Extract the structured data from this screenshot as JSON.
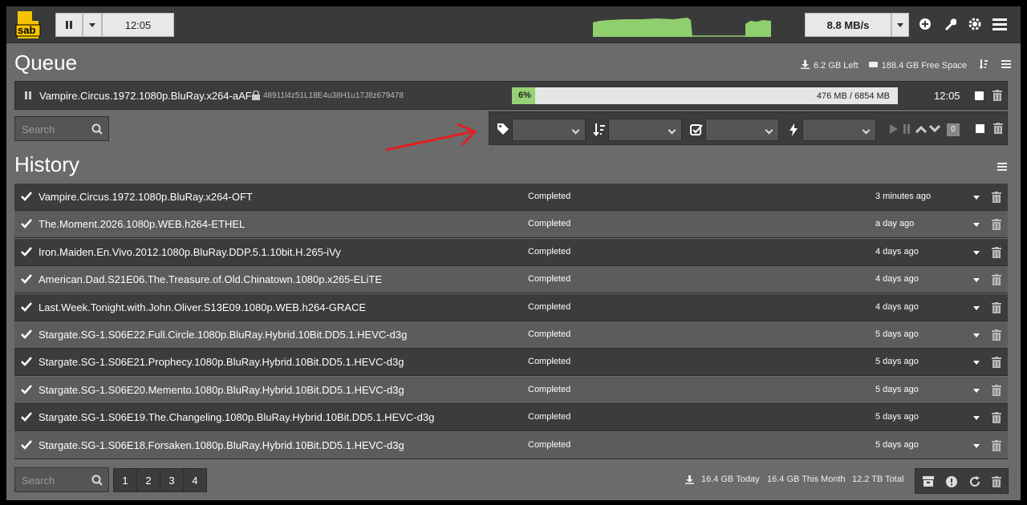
{
  "navbar": {
    "logo_text": "sab",
    "clock": "12:05",
    "speed_limit": "8.8 MB/s",
    "icons": [
      "pause-icon",
      "caret-down-icon",
      "add-icon",
      "wrench-icon",
      "gear-icon",
      "menu-icon"
    ]
  },
  "queue": {
    "title": "Queue",
    "left": "6.2 GB Left",
    "free_space": "188.4 GB Free Space",
    "item": {
      "name": "Vampire.Circus.1972.1080p.BluRay.x264-aAF",
      "password": "48911l4z51L18E4u38H1u17J8z679478",
      "progress_label": "6%",
      "progress": 0.06,
      "size": "476 MB / 6854 MB",
      "eta": "12:05"
    },
    "search_placeholder": "Search",
    "counter": "0",
    "colors": {
      "progress": "#95d175",
      "graph": "#8fcf6e"
    }
  },
  "history": {
    "title": "History",
    "rows": [
      {
        "name": "Vampire.Circus.1972.1080p.BluRay.x264-OFT",
        "status": "Completed",
        "time": "3 minutes ago"
      },
      {
        "name": "The.Moment.2026.1080p.WEB.h264-ETHEL",
        "status": "Completed",
        "time": "a day ago"
      },
      {
        "name": "Iron.Maiden.En.Vivo.2012.1080p.BluRay.DDP.5.1.10bit.H.265-iVy",
        "status": "Completed",
        "time": "4 days ago"
      },
      {
        "name": "American.Dad.S21E06.The.Treasure.of.Old.Chinatown.1080p.x265-ELiTE",
        "status": "Completed",
        "time": "4 days ago"
      },
      {
        "name": "Last.Week.Tonight.with.John.Oliver.S13E09.1080p.WEB.h264-GRACE",
        "status": "Completed",
        "time": "4 days ago"
      },
      {
        "name": "Stargate.SG-1.S06E22.Full.Circle.1080p.BluRay.Hybrid.10Bit.DD5.1.HEVC-d3g",
        "status": "Completed",
        "time": "5 days ago"
      },
      {
        "name": "Stargate.SG-1.S06E21.Prophecy.1080p.BluRay.Hybrid.10Bit.DD5.1.HEVC-d3g",
        "status": "Completed",
        "time": "5 days ago"
      },
      {
        "name": "Stargate.SG-1.S06E20.Memento.1080p.BluRay.Hybrid.10Bit.DD5.1.HEVC-d3g",
        "status": "Completed",
        "time": "5 days ago"
      },
      {
        "name": "Stargate.SG-1.S06E19.The.Changeling.1080p.BluRay.Hybrid.10Bit.DD5.1.HEVC-d3g",
        "status": "Completed",
        "time": "5 days ago"
      },
      {
        "name": "Stargate.SG-1.S06E18.Forsaken.1080p.BluRay.Hybrid.10Bit.DD5.1.HEVC-d3g",
        "status": "Completed",
        "time": "5 days ago"
      }
    ],
    "search_placeholder": "Search",
    "pages": [
      "1",
      "2",
      "3",
      "4"
    ],
    "today": "16.4 GB Today",
    "month": "16.4 GB This Month",
    "total": "12.2 TB Total"
  }
}
